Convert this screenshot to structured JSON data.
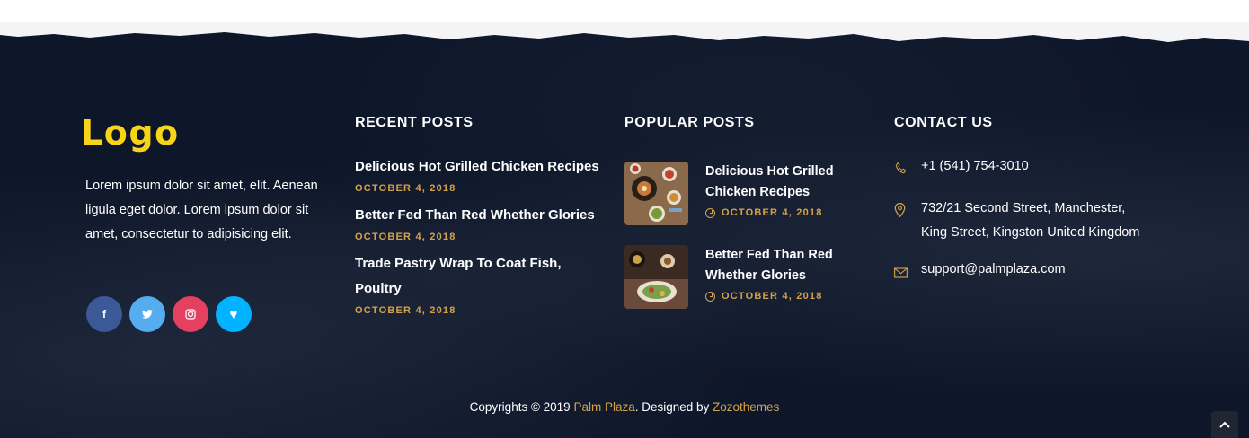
{
  "brand": {
    "logo_text": "Logo",
    "logo_color": "#f7d417",
    "accent_color": "#d4a24c",
    "background": "#0e1629"
  },
  "about": {
    "text": "Lorem ipsum dolor sit amet, elit. Aenean ligula eget dolor. Lorem ipsum dolor sit amet, consectetur to adipisicing elit."
  },
  "social": [
    {
      "name": "facebook",
      "glyph": "f",
      "color": "#3b5998"
    },
    {
      "name": "twitter",
      "glyph": "t",
      "color": "#55acee"
    },
    {
      "name": "instagram",
      "glyph": "ig",
      "color": "#e4405f"
    },
    {
      "name": "heart",
      "glyph": "♥",
      "color": "#00b2ff"
    }
  ],
  "recent_posts": {
    "title": "RECENT POSTS",
    "items": [
      {
        "title": "Delicious Hot Grilled Chicken Recipes",
        "date": "OCTOBER 4, 2018"
      },
      {
        "title": "Better Fed Than Red Whether Glories",
        "date": "OCTOBER 4, 2018"
      },
      {
        "title": "Trade Pastry Wrap To Coat Fish, Poultry",
        "date": "OCTOBER 4, 2018"
      }
    ]
  },
  "popular_posts": {
    "title": "POPULAR POSTS",
    "items": [
      {
        "title": "Delicious Hot Grilled Chicken Recipes",
        "date": "OCTOBER 4, 2018",
        "thumb_icon": "food-bowls-image"
      },
      {
        "title": "Better Fed Than Red Whether Glories",
        "date": "OCTOBER 4, 2018",
        "thumb_icon": "table-dishes-image"
      }
    ]
  },
  "contact": {
    "title": "CONTACT US",
    "phone": "+1 (541) 754-3010",
    "address": "732/21 Second Street, Manchester, King Street, Kingston United Kingdom",
    "email": "support@palmplaza.com"
  },
  "copyright": {
    "prefix": "Copyrights © 2019 ",
    "site": "Palm Plaza",
    "middle": ". Designed by ",
    "designer": "Zozothemes"
  }
}
